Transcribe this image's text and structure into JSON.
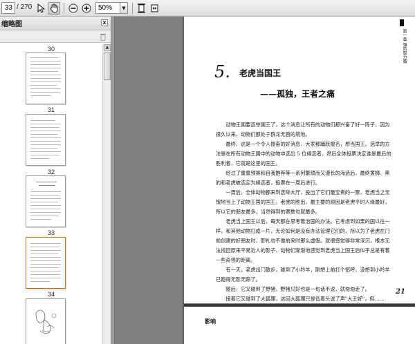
{
  "toolbar": {
    "current_page": "33",
    "page_total": "/ 270",
    "zoom": "50%",
    "buttons": [
      "select-tool",
      "hand-tool",
      "zoom-out",
      "zoom-in",
      "fit-page",
      "fit-width"
    ]
  },
  "sidebar": {
    "title": "缩略图",
    "close": "x",
    "thumbnails": [
      {
        "label": "30"
      },
      {
        "label": "31"
      },
      {
        "label": "32"
      },
      {
        "label": "33"
      },
      {
        "label": "34"
      }
    ]
  },
  "document": {
    "chapter_number": "5.",
    "chapter_title": "老虎当国王",
    "chapter_subtitle": "——孤独，王者之痛",
    "running_head": "第一章 强势智力篇",
    "page_number": "21",
    "next_page_text": "影响",
    "paragraphs": [
      "动物王国要选举国王了，这个消息让所有的动物们都兴奋了好一阵子，因为很久以来，动物们都处于群龙无首的境地。",
      "最终，这是一个令人振奋的好消息，大家都踊跃报名，想当国王。选举的方法是在所有动物王国中的动物中选出 5 位候选者，然后全体投票决定谁是最后的胜利者，它就是这里的国王。",
      "经过了重重预赛和自我推荐等一系列繁琐而又漫长的海选后，最终黄狮、黑豹和老虎被选定为候选者，投票在一周后进行。",
      "一周后，全体动物都来到选举大厅，投出了它们最宝贵的一票，老虎当之无愧地当上了动物王国的国王。老虎的胜出，最主要的原因是老虎平时人缘最好，所以它的朋友最多，当然得到的票数也就最多。",
      "老虎当上国王以后，每天都在思考着治国的办法。它考虑到如果的国以往一样，和其他动物打成一片，无论如何是没有办法管理它们的，所以为了老虎在门前创建的好朋友时，即礼也不像前来时那么虚假。就很感觉得非常深沉，根本无法找回原来平易近人的影子，动物们渐渐地感觉到老虎当上国王后似乎总是有着一些奇怪的距离。",
      "有一天，老虎出门散步，碰到了小羚羊，刚想上前打个招呼，没想到小羚羊已跑得无影无踪了。",
      "随后，它又碰到了野猪，野猪只好也是一句话不说，就匆匆走了。",
      "接着它又碰到了大狐狸，这回大狐狸只是低着头说了声\"大王好\"，但……"
    ]
  }
}
